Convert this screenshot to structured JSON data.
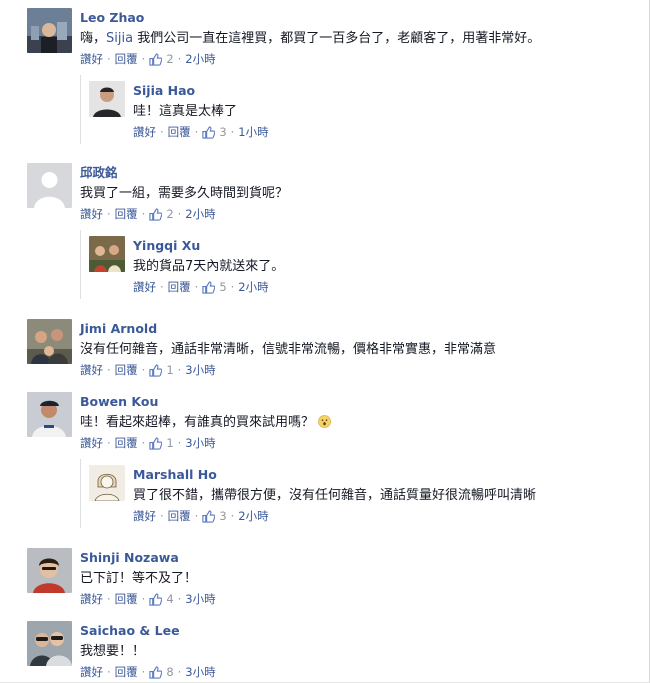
{
  "comments": [
    {
      "name": "Leo Zhao",
      "text_prefix": "嗨，",
      "mention": "Sijia",
      "text": " 我們公司一直在這裡買，都買了一百多台了，老顧客了，用著非常好。",
      "like_label": "讚好",
      "reply_label": "回覆",
      "likes": "2",
      "time": "2小時",
      "reply": {
        "name": "Sijia Hao",
        "text": "哇！這真是太棒了",
        "like_label": "讚好",
        "reply_label": "回覆",
        "likes": "3",
        "time": "1小時"
      }
    },
    {
      "name": "邱政銘",
      "text": "我買了一組，需要多久時間到貨呢？",
      "like_label": "讚好",
      "reply_label": "回覆",
      "likes": "2",
      "time": "2小時",
      "reply": {
        "name": "Yingqi Xu",
        "text": "我的貨品7天內就送來了。",
        "like_label": "讚好",
        "reply_label": "回覆",
        "likes": "5",
        "time": "2小時"
      }
    },
    {
      "name": "Jimi Arnold",
      "text": "沒有任何雜音，通話非常清晰，信號非常流暢，價格非常實惠，非常滿意",
      "like_label": "讚好",
      "reply_label": "回覆",
      "likes": "1",
      "time": "3小時"
    },
    {
      "name": "Bowen Kou",
      "text": "哇！看起來超棒，有誰真的買來試用嗎？",
      "like_label": "讚好",
      "reply_label": "回覆",
      "likes": "1",
      "time": "3小時",
      "reply": {
        "name": "Marshall Ho",
        "text": "買了很不錯，攜帶很方便，沒有任何雜音，通話質量好很流暢呼叫清晰",
        "like_label": "讚好",
        "reply_label": "回覆",
        "likes": "3",
        "time": "2小時"
      }
    },
    {
      "name": "Shinji Nozawa",
      "text": "已下訂！等不及了！",
      "like_label": "讚好",
      "reply_label": "回覆",
      "likes": "4",
      "time": "3小時"
    },
    {
      "name": "Saichao & Lee",
      "text": "我想要！！",
      "like_label": "讚好",
      "reply_label": "回覆",
      "likes": "8",
      "time": "3小時"
    }
  ],
  "icons": {
    "like": "thumbs-up-icon",
    "emoji": "surprised-face-icon"
  },
  "colors": {
    "name": "#3b5998",
    "meta": "#9197a3",
    "text": "#141823"
  }
}
